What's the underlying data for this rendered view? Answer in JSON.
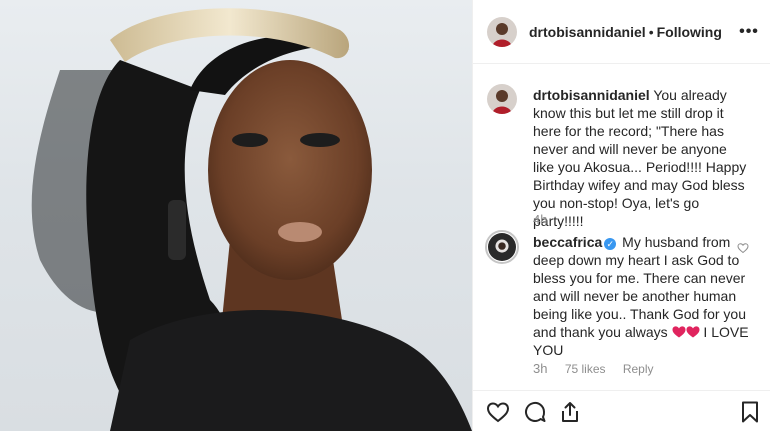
{
  "post": {
    "username": "drtobisannidaniel",
    "separator": "•",
    "follow_state": "Following",
    "more_icon": "more-options-icon",
    "photo_description_icon": "portrait-photo"
  },
  "comments": [
    {
      "username": "drtobisannidaniel",
      "text": "You already know this but let me still drop it here for the record; \"There has never and will never be anyone like you Akosua... Period!!!! Happy Birthday wifey and may God bless you non-stop! Oya, let's go party!!!!!",
      "time": "4h"
    },
    {
      "username": "beccafrica",
      "verified": true,
      "text": "My husband from deep down my heart I ask God to bless you for me. There can never and will never be another human being like you.. Thank God for you and thank you always",
      "text_end": "I LOVE YOU",
      "time": "3h",
      "likes": "75 likes",
      "reply_label": "Reply"
    }
  ],
  "actions": {
    "like_icon": "heart-icon",
    "comment_icon": "comment-icon",
    "share_icon": "share-icon",
    "save_icon": "bookmark-icon"
  },
  "colors": {
    "text": "#262626",
    "muted": "#8e8e8e",
    "divider": "#efefef",
    "verified": "#3897f0",
    "heart_emoji": "#e0245e"
  }
}
